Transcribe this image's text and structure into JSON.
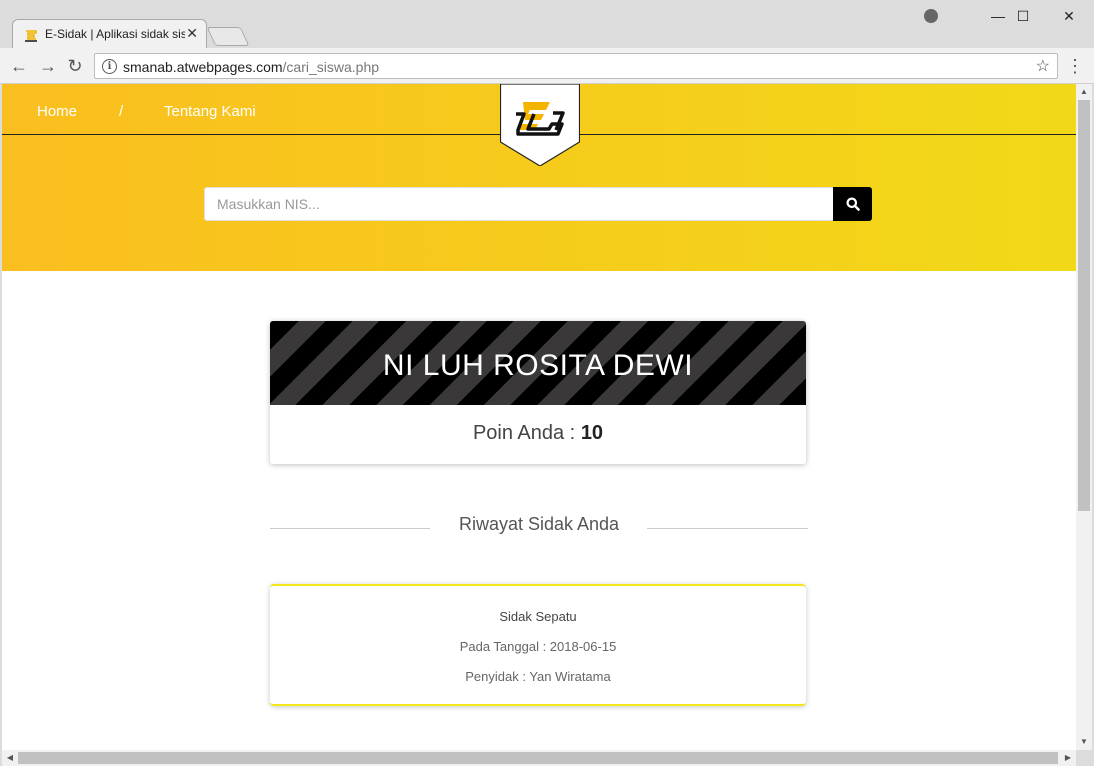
{
  "browser": {
    "tab_title": "E-Sidak | Aplikasi sidak siswa",
    "tab_close": "✕",
    "url_host": "smanab.atwebpages.com",
    "url_path": "/cari_siswa.php",
    "window_minimize": "—",
    "window_maximize": "☐",
    "window_close": "✕",
    "back": "←",
    "forward": "→",
    "reload": "↻",
    "info": "i",
    "star": "☆",
    "menu": "⋮"
  },
  "site": {
    "nav": {
      "home": "Home",
      "separator": "/",
      "about": "Tentang Kami"
    },
    "search": {
      "placeholder": "Masukkan NIS..."
    },
    "brand_color": "#f5c21b"
  },
  "student": {
    "name": "NI LUH ROSITA DEWI",
    "points_label": "Poin Anda : ",
    "points_value": "10"
  },
  "history": {
    "section_title": "Riwayat Sidak Anda",
    "items": [
      {
        "title": "Sidak Sepatu",
        "date": "Pada Tanggal : 2018-06-15",
        "inspector": "Penyidak : Yan Wiratama"
      }
    ]
  },
  "icons": {
    "search": "search-icon",
    "logo": "e-sidak-logo-icon"
  }
}
